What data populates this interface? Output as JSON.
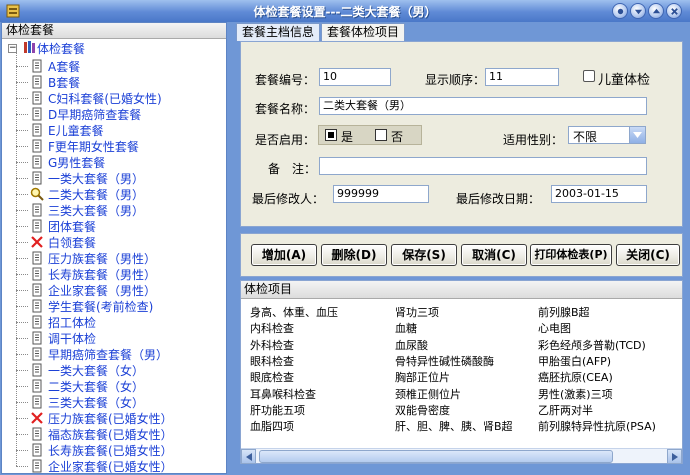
{
  "window": {
    "title": "体检套餐设置---二类大套餐（男）"
  },
  "tree": {
    "header": "体检套餐",
    "root_label": "体检套餐",
    "root_expander": "−",
    "items": [
      {
        "label": "A套餐",
        "icon": "doc"
      },
      {
        "label": "B套餐",
        "icon": "doc"
      },
      {
        "label": "C妇科套餐(已婚女性)",
        "icon": "doc"
      },
      {
        "label": "D早期癌筛查套餐",
        "icon": "doc"
      },
      {
        "label": "E儿童套餐",
        "icon": "doc"
      },
      {
        "label": "F更年期女性套餐",
        "icon": "doc"
      },
      {
        "label": "G男性套餐",
        "icon": "doc"
      },
      {
        "label": "一类大套餐（男）",
        "icon": "doc"
      },
      {
        "label": "二类大套餐（男）",
        "icon": "magnifier"
      },
      {
        "label": "三类大套餐（男）",
        "icon": "doc"
      },
      {
        "label": "团体套餐",
        "icon": "doc"
      },
      {
        "label": "白领套餐",
        "icon": "redx"
      },
      {
        "label": "压力族套餐（男性）",
        "icon": "doc"
      },
      {
        "label": "长寿族套餐（男性）",
        "icon": "doc"
      },
      {
        "label": "企业家套餐（男性）",
        "icon": "doc"
      },
      {
        "label": "学生套餐(考前检查)",
        "icon": "doc"
      },
      {
        "label": "招工体检",
        "icon": "doc"
      },
      {
        "label": "调干体检",
        "icon": "doc"
      },
      {
        "label": "早期癌筛查套餐（男）",
        "icon": "doc"
      },
      {
        "label": "一类大套餐（女）",
        "icon": "doc"
      },
      {
        "label": "二类大套餐（女）",
        "icon": "doc"
      },
      {
        "label": "三类大套餐（女）",
        "icon": "doc"
      },
      {
        "label": "压力族套餐(已婚女性）",
        "icon": "redx"
      },
      {
        "label": "福态族套餐(已婚女性）",
        "icon": "doc"
      },
      {
        "label": "长寿族套餐(已婚女性）",
        "icon": "doc"
      },
      {
        "label": "企业家套餐(已婚女性）",
        "icon": "doc"
      }
    ]
  },
  "tabs": [
    {
      "label": "套餐主档信息",
      "active": false
    },
    {
      "label": "套餐体检项目",
      "active": true
    }
  ],
  "form": {
    "code_label": "套餐编号：",
    "code_value": "10",
    "order_label": "显示顺序：",
    "order_value": "11",
    "child_label": "儿童体检",
    "name_label": "套餐名称：",
    "name_value": "二类大套餐（男）",
    "enabled_label": "是否启用：",
    "enabled_yes": "是",
    "enabled_no": "否",
    "gender_label": "适用性别：",
    "gender_value": "不限",
    "remark_label": "备　注：",
    "remark_value": "",
    "modifier_label": "最后修改人：",
    "modifier_value": "999999",
    "modified_date_label": "最后修改日期：",
    "modified_date_value": "2003-01-15"
  },
  "buttons": {
    "add": "增加(A)",
    "delete": "删除(D)",
    "save": "保存(S)",
    "cancel": "取消(C)",
    "print": "打印体检表(P)",
    "close": "关闭(C)"
  },
  "exam_items": {
    "header": "体检项目",
    "columns": [
      [
        "身高、体重、血压",
        "内科检查",
        "外科检查",
        "眼科检查",
        "眼底检查",
        "耳鼻喉科检查",
        "肝功能五项",
        "血脂四项"
      ],
      [
        "肾功三项",
        "血糖",
        "血尿酸",
        "骨特异性碱性磷酸酶",
        "胸部正位片",
        "颈椎正侧位片",
        "双能骨密度",
        "肝、胆、脾、胰、肾B超"
      ],
      [
        "前列腺B超",
        "心电图",
        "彩色经颅多普勒(TCD)",
        "甲胎蛋白(AFP)",
        "癌胚抗原(CEA)",
        "男性(激素)三项",
        "乙肝两对半",
        "前列腺特异性抗原(PSA)"
      ]
    ]
  },
  "colors": {
    "tree_text": "#1a3fd6",
    "window_bg": "#6f97d6",
    "panel_bg": "#edecdf"
  }
}
